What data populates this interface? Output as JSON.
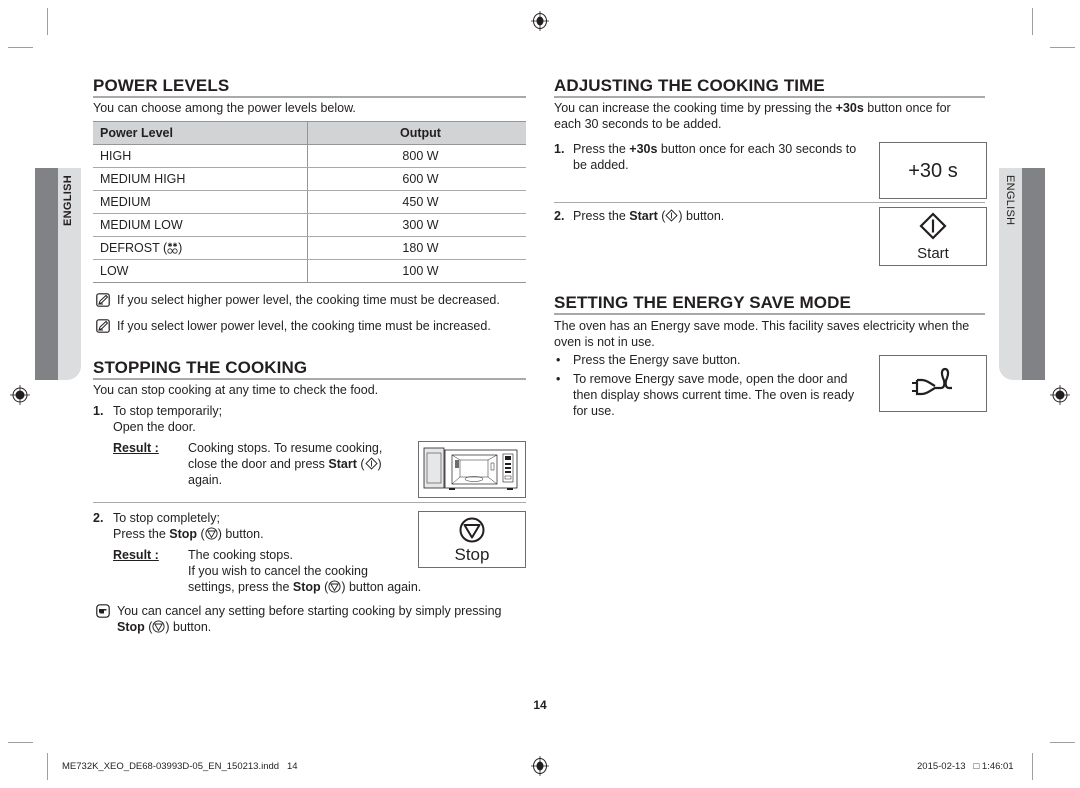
{
  "page": {
    "page_number": "14",
    "side_tab_left": "ENGLISH",
    "side_tab_right": "ENGLISH",
    "footer_file": "ME732K_XEO_DE68-03993D-05_EN_150213.indd   14",
    "footer_timestamp": "2015-02-13   □ 1:46:01"
  },
  "power_levels": {
    "heading": "POWER LEVELS",
    "intro": "You can choose among the power levels below.",
    "table": {
      "headers": [
        "Power Level",
        "Output"
      ],
      "rows": [
        {
          "level": "HIGH",
          "output": "800 W"
        },
        {
          "level": "MEDIUM HIGH",
          "output": "600 W"
        },
        {
          "level": "MEDIUM",
          "output": "450 W"
        },
        {
          "level": "MEDIUM LOW",
          "output": "300 W"
        },
        {
          "level": "DEFROST (",
          "level_icon": "defrost-icon",
          "level_suffix": ")",
          "output": "180 W"
        },
        {
          "level": "LOW",
          "output": "100 W"
        }
      ]
    },
    "notes": [
      "If you select higher power level, the cooking time must be decreased.",
      "If you select lower power level, the cooking time must be increased."
    ]
  },
  "stopping": {
    "heading": "STOPPING THE COOKING",
    "intro": "You can stop cooking at any time to check the food.",
    "step1": {
      "num": "1.",
      "line1": "To stop temporarily;",
      "line2": "Open the door.",
      "result_label": "Result :",
      "result_l1": "Cooking stops. To resume cooking,",
      "result_l2_pre": "close the door and press ",
      "result_l2_bold": "Start",
      "result_l2_post": " (",
      "result_l2_end": ")",
      "result_l3": "again.",
      "image": "microwave-door-open"
    },
    "step2": {
      "num": "2.",
      "line1": "To stop completely;",
      "line2_pre": "Press the ",
      "line2_bold": "Stop",
      "line2_mid": " (",
      "line2_post": ") button.",
      "result_label": "Result :",
      "result_l1": "The cooking stops.",
      "result_l2": "If you wish to cancel the cooking",
      "result_l3_pre": "settings, press the ",
      "result_l3_bold": "Stop",
      "result_l3_mid": " (",
      "result_l3_post": ") button again.",
      "button_label": "Stop"
    },
    "tip_pre": "You can cancel any setting before starting cooking by simply pressing",
    "tip_bold": "Stop",
    "tip_mid": " (",
    "tip_post": ") button."
  },
  "adjusting": {
    "heading": "ADJUSTING THE COOKING TIME",
    "intro_pre": "You can increase the cooking time by pressing the ",
    "intro_bold": "+30s",
    "intro_post": " button once for",
    "intro_l2": "each 30 seconds to be added.",
    "step1": {
      "num": "1.",
      "pre": "Press the ",
      "bold": "+30s",
      "post": " button once for each 30 seconds to",
      "l2": "be added.",
      "button_label": "+30 s"
    },
    "step2": {
      "num": "2.",
      "pre": "Press the ",
      "bold": "Start",
      "mid": " (",
      "post": ") button.",
      "button_label": "Start"
    }
  },
  "energy_save": {
    "heading": "SETTING THE ENERGY SAVE MODE",
    "intro_l1": "The oven has an Energy save mode. This facility saves electricity when the",
    "intro_l2": "oven is not in use.",
    "bullets": [
      {
        "l1": "Press the Energy save button."
      },
      {
        "l1": "To remove Energy save mode, open the door and",
        "l2": "then display shows current time. The oven is ready",
        "l3": "for use."
      }
    ],
    "button_icon": "energy-save-plug-icon"
  }
}
